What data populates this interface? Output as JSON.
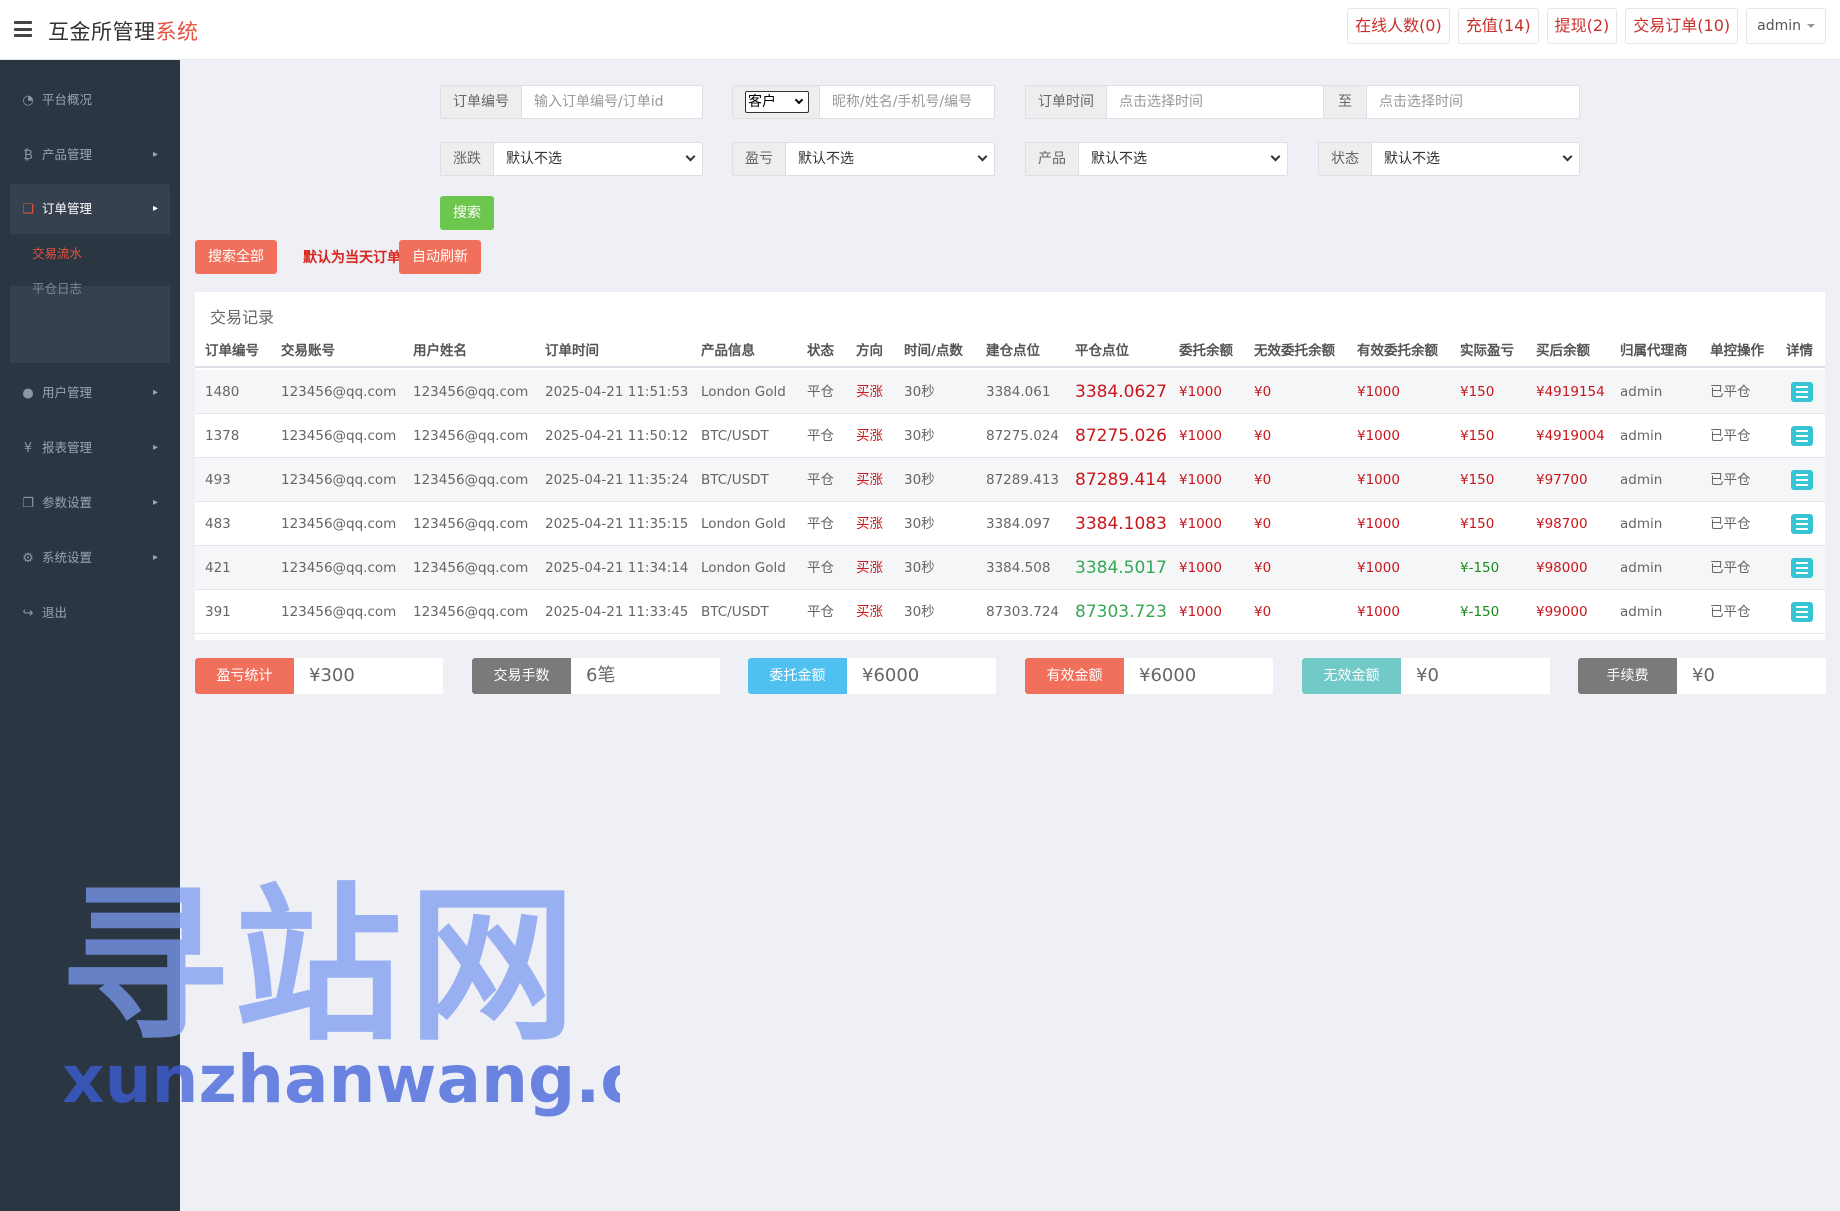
{
  "header": {
    "brand_main": "互金所管理",
    "brand_highlight": "系统",
    "nav": [
      {
        "label": "在线人数(0)"
      },
      {
        "label": "充值(14)"
      },
      {
        "label": "提现(2)"
      },
      {
        "label": "交易订单(10)"
      }
    ],
    "user": "admin"
  },
  "sidebar": {
    "items": [
      {
        "label": "平台概况",
        "icon": "dashboard-icon"
      },
      {
        "label": "产品管理",
        "icon": "bitcoin-icon"
      },
      {
        "label": "订单管理",
        "icon": "orders-icon"
      },
      {
        "label": "用户管理",
        "icon": "user-icon"
      },
      {
        "label": "报表管理",
        "icon": "yen-icon"
      },
      {
        "label": "参数设置",
        "icon": "copy-icon"
      },
      {
        "label": "系统设置",
        "icon": "gears-icon"
      },
      {
        "label": "退出",
        "icon": "logout-icon"
      }
    ],
    "sub_items": [
      {
        "label": "交易流水"
      },
      {
        "label": "平仓日志"
      }
    ],
    "active_color": "#e4533e"
  },
  "filters": {
    "order_no_label": "订单编号",
    "order_no_placeholder": "输入订单编号/订单id",
    "customer_type": "客户",
    "customer_placeholder": "昵称/姓名/手机号/编号",
    "time_label": "订单时间",
    "time_start_placeholder": "点击选择时间",
    "to_label": "至",
    "time_end_placeholder": "点击选择时间",
    "rise_fall_label": "涨跌",
    "profit_label": "盈亏",
    "product_label": "产品",
    "status_label": "状态",
    "default_option": "默认不选",
    "search_button": "搜索",
    "search_all_button": "搜索全部",
    "default_note": "默认为当天订单",
    "auto_refresh_button": "自动刷新"
  },
  "table": {
    "title": "交易记录",
    "columns": [
      "订单编号",
      "交易账号",
      "用户姓名",
      "订单时间",
      "产品信息",
      "状态",
      "方向",
      "时间/点数",
      "建仓点位",
      "平仓点位",
      "委托余额",
      "无效委托余额",
      "有效委托余额",
      "实际盈亏",
      "买后余额",
      "归属代理商",
      "单控操作",
      "详情"
    ],
    "rows": [
      {
        "id": "1480",
        "account": "123456@qq.com",
        "name": "123456@qq.com",
        "time": "2025-04-21 11:51:53",
        "product": "London Gold",
        "status": "平仓",
        "direction": "买涨",
        "duration": "30秒",
        "open": "3384.061",
        "close": "3384.0627",
        "close_color": "red",
        "entrust": "¥1000",
        "invalid": "¥0",
        "valid": "¥1000",
        "pnl": "¥150",
        "pnl_color": "red",
        "balance": "¥4919154",
        "agent": "admin",
        "control": "已平仓"
      },
      {
        "id": "1378",
        "account": "123456@qq.com",
        "name": "123456@qq.com",
        "time": "2025-04-21 11:50:12",
        "product": "BTC/USDT",
        "status": "平仓",
        "direction": "买涨",
        "duration": "30秒",
        "open": "87275.024",
        "close": "87275.026",
        "close_color": "red",
        "entrust": "¥1000",
        "invalid": "¥0",
        "valid": "¥1000",
        "pnl": "¥150",
        "pnl_color": "red",
        "balance": "¥4919004",
        "agent": "admin",
        "control": "已平仓"
      },
      {
        "id": "493",
        "account": "123456@qq.com",
        "name": "123456@qq.com",
        "time": "2025-04-21 11:35:24",
        "product": "BTC/USDT",
        "status": "平仓",
        "direction": "买涨",
        "duration": "30秒",
        "open": "87289.413",
        "close": "87289.414",
        "close_color": "red",
        "entrust": "¥1000",
        "invalid": "¥0",
        "valid": "¥1000",
        "pnl": "¥150",
        "pnl_color": "red",
        "balance": "¥97700",
        "agent": "admin",
        "control": "已平仓"
      },
      {
        "id": "483",
        "account": "123456@qq.com",
        "name": "123456@qq.com",
        "time": "2025-04-21 11:35:15",
        "product": "London Gold",
        "status": "平仓",
        "direction": "买涨",
        "duration": "30秒",
        "open": "3384.097",
        "close": "3384.1083",
        "close_color": "red",
        "entrust": "¥1000",
        "invalid": "¥0",
        "valid": "¥1000",
        "pnl": "¥150",
        "pnl_color": "red",
        "balance": "¥98700",
        "agent": "admin",
        "control": "已平仓"
      },
      {
        "id": "421",
        "account": "123456@qq.com",
        "name": "123456@qq.com",
        "time": "2025-04-21 11:34:14",
        "product": "London Gold",
        "status": "平仓",
        "direction": "买涨",
        "duration": "30秒",
        "open": "3384.508",
        "close": "3384.5017",
        "close_color": "green",
        "entrust": "¥1000",
        "invalid": "¥0",
        "valid": "¥1000",
        "pnl": "¥-150",
        "pnl_color": "green",
        "balance": "¥98000",
        "agent": "admin",
        "control": "已平仓"
      },
      {
        "id": "391",
        "account": "123456@qq.com",
        "name": "123456@qq.com",
        "time": "2025-04-21 11:33:45",
        "product": "BTC/USDT",
        "status": "平仓",
        "direction": "买涨",
        "duration": "30秒",
        "open": "87303.724",
        "close": "87303.723",
        "close_color": "green",
        "entrust": "¥1000",
        "invalid": "¥0",
        "valid": "¥1000",
        "pnl": "¥-150",
        "pnl_color": "green",
        "balance": "¥99000",
        "agent": "admin",
        "control": "已平仓"
      }
    ]
  },
  "stats": [
    {
      "label": "盈亏统计",
      "value": "¥300",
      "color": "#f0705b"
    },
    {
      "label": "交易手数",
      "value": "6笔",
      "color": "#7a7a7a"
    },
    {
      "label": "委托金额",
      "value": "¥6000",
      "color": "#4fc0ef"
    },
    {
      "label": "有效金额",
      "value": "¥6000",
      "color": "#f0705b"
    },
    {
      "label": "无效金额",
      "value": "¥0",
      "color": "#71c9c8"
    },
    {
      "label": "手续费",
      "value": "¥0",
      "color": "#7a7a7a"
    }
  ],
  "watermark": {
    "line1": "寻站网",
    "line2": "xunzhanwang.com"
  }
}
